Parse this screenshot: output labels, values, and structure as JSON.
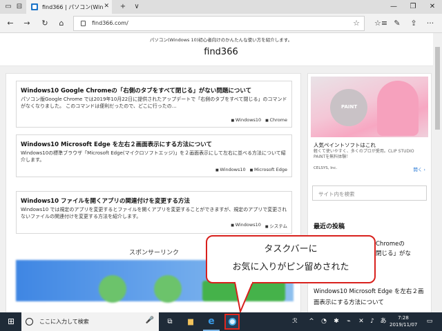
{
  "browser": {
    "tab_title": "find366 | パソコン(Windows",
    "tab_close": "✕",
    "new_tab": "+",
    "tab_menu": "∨",
    "window": {
      "minimize": "—",
      "maximize": "❐",
      "close": "✕"
    },
    "nav": {
      "back": "←",
      "forward": "→",
      "refresh": "↻",
      "home": "⌂"
    },
    "address": "find366.com/",
    "star": "☆",
    "toolbar_icons": {
      "favorites": "☆≡",
      "notes": "✎",
      "share": "⇪",
      "more": "···"
    }
  },
  "site": {
    "tagline": "パソコン(Windows 10)初心者向けのかんたんな使い方を紹介します。",
    "logo": "find366"
  },
  "articles": [
    {
      "title": "Windows10 Google Chromeの「右側のタブをすべて閉じる」がない問題について",
      "excerpt": "パソコン版Google Chrome では2019年10月22日に提供されたアップデートで「右側のタブをすべて閉じる」のコマンドがなくなりました。 このコマンドは便利だったので、どこに行ったの…",
      "tags": [
        "Windows10",
        "Chrome"
      ]
    },
    {
      "title": "Windows10 Microsoft Edge を左右２画面表示にする方法について",
      "excerpt": "Windows10の標準ブラウザ「Microsoft Edge(マイクロソフトエッジ)」を２画面表示にして左右に並べる方法について紹介します。",
      "tags": [
        "Windows10",
        "Microsoft Edge"
      ]
    },
    {
      "title": "Windows10 ファイルを開くアプリの関連付けを変更する方法",
      "excerpt": "Windows10 では規定のアプリを変更するとファイルを開くアプリを変更することができますが、規定のアプリで変更されないファイルの関連付けを変更する方法を紹介します。",
      "tags": [
        "Windows10",
        "システム"
      ]
    }
  ],
  "sponsor_label": "スポンサーリンク",
  "sidebar": {
    "ad": {
      "art_text": "PAINT",
      "title": "人気ペイントソフトはこれ",
      "desc": "軽くて使いやすく、多くのプロが愛用。CLIP STUDIO PAINTを無料体験！",
      "brand": "CELSYS, Inc.",
      "more": "開く ›"
    },
    "search_placeholder": "サイト内を検索",
    "recent_heading": "最近の投稿",
    "recent_1": "Chromeの\n閉じる」がな",
    "recent_2": "Windows10 Microsoft Edge を左右２画面表示にする方法について"
  },
  "callout": {
    "line1": "タスクバーに",
    "line2": "お気に入りがピン留めされた"
  },
  "taskbar": {
    "start": "⊞",
    "search_text": "ここに入力して検索",
    "mic": "🎤",
    "taskview": "⧉",
    "explorer": "▆",
    "edge": "e",
    "clock_time": "7:28",
    "clock_date": "2019/11/07",
    "tray": [
      "ℛ",
      "^",
      "◔",
      "✱",
      "⌁",
      "✕",
      "♪",
      "あ",
      "▭"
    ]
  },
  "colors": {
    "callout_border": "#d8201c",
    "taskbar": "#1f2b38",
    "edge_blue": "#1a73c8"
  }
}
